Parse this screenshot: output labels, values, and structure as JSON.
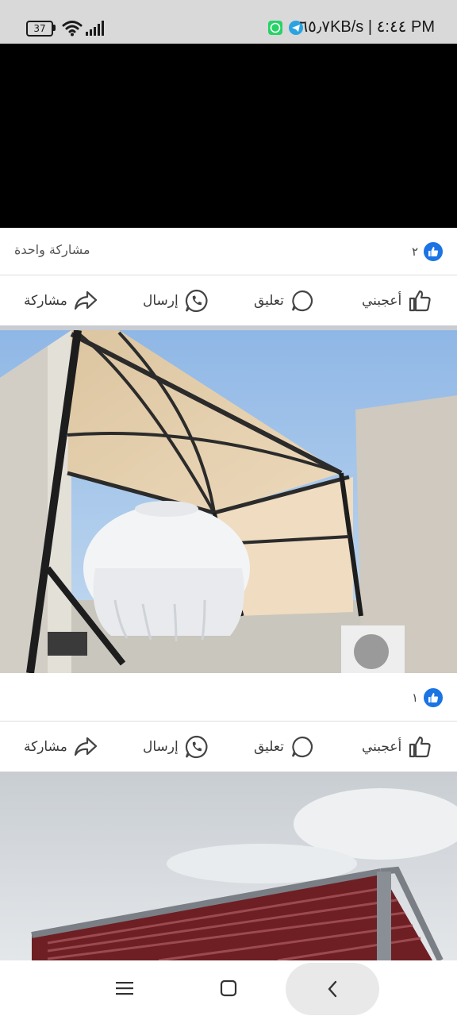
{
  "status_bar": {
    "battery": "37",
    "network_speed": "٦٥٫٧KB/s",
    "separator": "|",
    "time": "٤:٤٤ PM",
    "icons": [
      "battery-icon",
      "wifi-icon",
      "signal-icon",
      "whatsapp-icon",
      "telegram-icon"
    ]
  },
  "post1": {
    "reaction_count": "٢",
    "shares": "مشاركة واحدة",
    "actions": {
      "like": "أعجبني",
      "comment": "تعليق",
      "send": "إرسال",
      "share": "مشاركة"
    }
  },
  "post2": {
    "reaction_count": "١",
    "actions": {
      "like": "أعجبني",
      "comment": "تعليق",
      "send": "إرسال",
      "share": "مشاركة"
    }
  },
  "colors": {
    "like_blue": "#1b74e4",
    "whatsapp": "#25d366",
    "telegram": "#2aa3e0"
  }
}
